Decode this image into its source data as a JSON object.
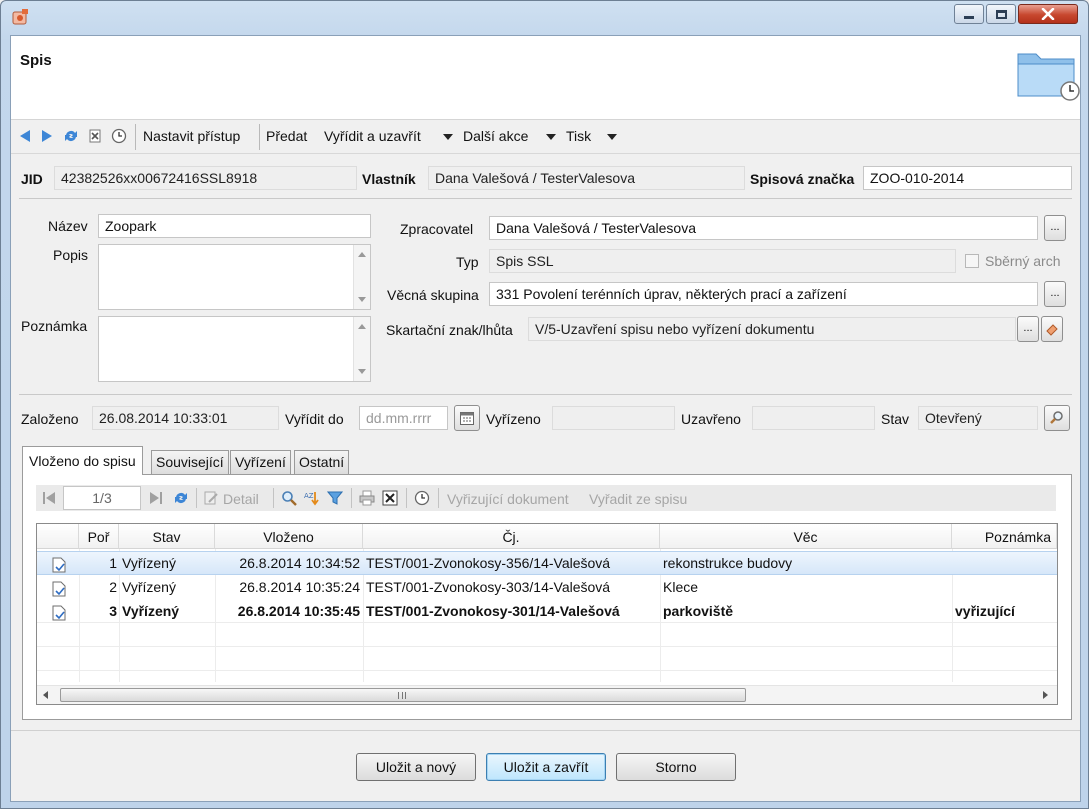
{
  "window": {
    "title": ""
  },
  "header": {
    "title": "Spis"
  },
  "toolbar": {
    "set_access": "Nastavit přístup",
    "handover": "Předat",
    "settle_close": "Vyřídit a uzavřít",
    "more_actions": "Další akce",
    "print": "Tisk"
  },
  "info": {
    "jid_label": "JID",
    "jid_value": "42382526xx00672416SSL8918",
    "owner_label": "Vlastník",
    "owner_value": "Dana Valešová / TesterValesova",
    "file_mark_label": "Spisová značka",
    "file_mark_value": "ZOO-010-2014"
  },
  "form": {
    "name_label": "Název",
    "name_value": "Zoopark",
    "desc_label": "Popis",
    "desc_value": "",
    "note_label": "Poznámka",
    "note_value": "",
    "processor_label": "Zpracovatel",
    "processor_value": "Dana Valešová / TesterValesova",
    "type_label": "Typ",
    "type_value": "Spis SSL",
    "collect_sheet_label": "Sběrný arch",
    "subject_group_label": "Věcná skupina",
    "subject_group_value": "331 Povolení terénních úprav, některých prací a zařízení",
    "retention_label": "Skartační znak/lhůta",
    "retention_value": "V/5-Uzavření spisu nebo vyřízení dokumentu",
    "browse_label": "..."
  },
  "dates": {
    "created_label": "Založeno",
    "created_value": "26.08.2014 10:33:01",
    "due_label": "Vyřídit do",
    "due_placeholder": "dd.mm.rrrr",
    "settled_label": "Vyřízeno",
    "settled_value": "",
    "closed_label": "Uzavřeno",
    "closed_value": "",
    "state_label": "Stav",
    "state_value": "Otevřený"
  },
  "tabs": [
    {
      "label": "Vloženo do spisu",
      "active": true
    },
    {
      "label": "Související"
    },
    {
      "label": "Vyřízení"
    },
    {
      "label": "Ostatní"
    }
  ],
  "grid_toolbar": {
    "page": "1/3",
    "detail": "Detail",
    "settling_doc": "Vyřizující dokument",
    "remove_from_file": "Vyřadit ze spisu"
  },
  "table": {
    "columns": [
      "Poř",
      "Stav",
      "Vloženo",
      "Čj.",
      "Věc",
      "Poznámka"
    ],
    "rows": [
      {
        "por": "1",
        "stav": "Vyřízený",
        "vlozeno": "26.8.2014 10:34:52",
        "cj": "TEST/001-Zvonokosy-356/14-Valešová",
        "vec": "rekonstrukce budovy",
        "poznamka": ""
      },
      {
        "por": "2",
        "stav": "Vyřízený",
        "vlozeno": "26.8.2014 10:35:24",
        "cj": "TEST/001-Zvonokosy-303/14-Valešová",
        "vec": "Klece",
        "poznamka": ""
      },
      {
        "por": "3",
        "stav": "Vyřízený",
        "vlozeno": "26.8.2014 10:35:45",
        "cj": "TEST/001-Zvonokosy-301/14-Valešová",
        "vec": "parkoviště",
        "poznamka": "vyřizující"
      }
    ]
  },
  "footer": {
    "save_new": "Uložit a nový",
    "save_close": "Uložit a zavřít",
    "cancel": "Storno"
  },
  "colors": {
    "selection": "#d6e7f9",
    "primary_button": "#bee6fd",
    "close_button": "#c7472e",
    "toolbar_blue": "#3d86d6"
  }
}
